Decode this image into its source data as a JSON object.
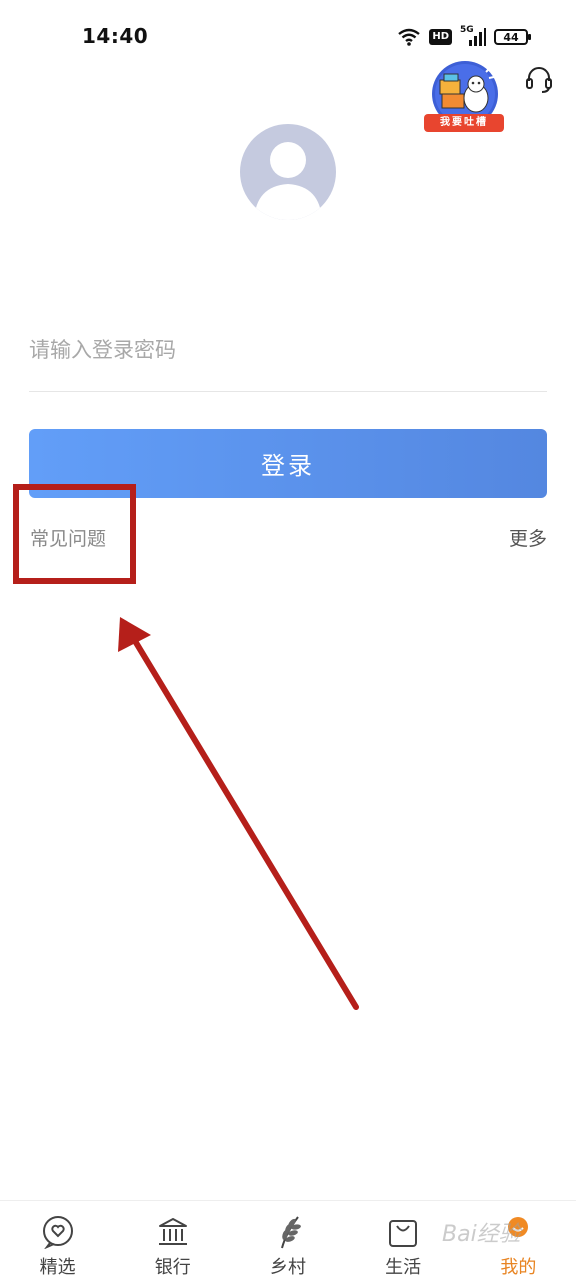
{
  "status_bar": {
    "time": "14:40",
    "hd": "HD",
    "network": "5G",
    "battery": "44"
  },
  "promo": {
    "label": "我要吐槽"
  },
  "login": {
    "password_placeholder": "请输入登录密码",
    "login_button": "登录",
    "faq": "常见问题",
    "more": "更多"
  },
  "bottom_nav": {
    "items": [
      {
        "label": "精选",
        "icon": "heart-bubble-icon"
      },
      {
        "label": "银行",
        "icon": "bank-icon"
      },
      {
        "label": "乡村",
        "icon": "wheat-icon"
      },
      {
        "label": "生活",
        "icon": "shopping-bag-icon"
      },
      {
        "label": "我的",
        "icon": "profile-icon"
      }
    ]
  },
  "watermark": "Bai经验",
  "colors": {
    "primary": "#5b93ee",
    "accent": "#e88422",
    "annotation": "#b51f1a",
    "avatar": "#c5cadf"
  }
}
